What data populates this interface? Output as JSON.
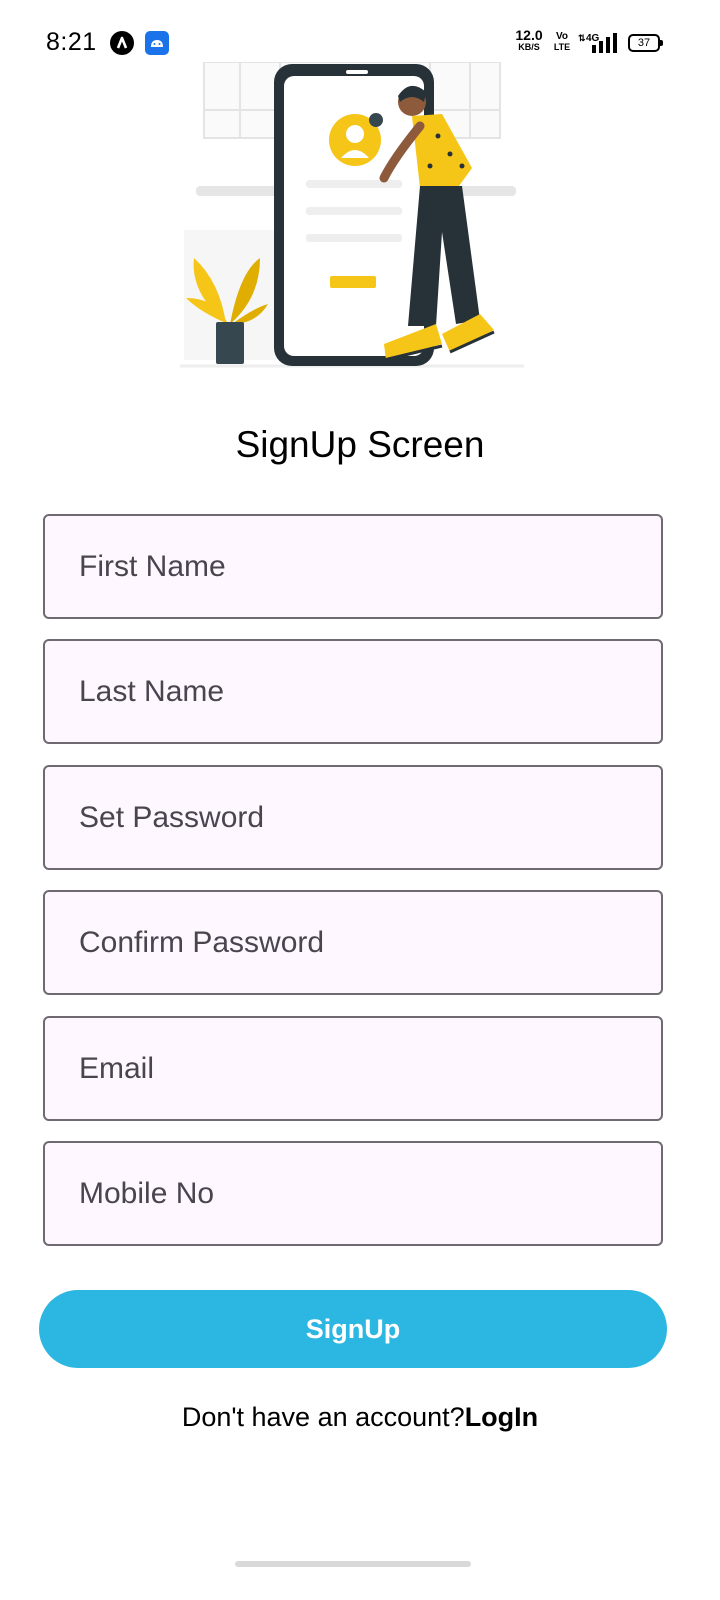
{
  "status_bar": {
    "time": "8:21",
    "net_speed_value": "12.0",
    "net_speed_unit": "KB/S",
    "volte_top": "Vo",
    "volte_bottom": "LTE",
    "network": "4G",
    "battery": "37",
    "icons": [
      "app-a-icon",
      "android-icon",
      "wifi-arrows-icon",
      "signal-bars-icon",
      "battery-icon"
    ]
  },
  "title": "SignUp Screen",
  "fields": {
    "first_name": "First Name",
    "last_name": "Last Name",
    "set_password": "Set Password",
    "confirm_password": "Confirm Password",
    "email": "Email",
    "mobile_no": "Mobile No"
  },
  "signup_button": "SignUp",
  "footer": {
    "prompt": "Don't have an account?",
    "login_link": "LogIn"
  },
  "colors": {
    "accent": "#2cb7e2",
    "field_bg": "#fef7ff",
    "field_border": "#6f6a72",
    "illustration_yellow": "#f5c518"
  }
}
